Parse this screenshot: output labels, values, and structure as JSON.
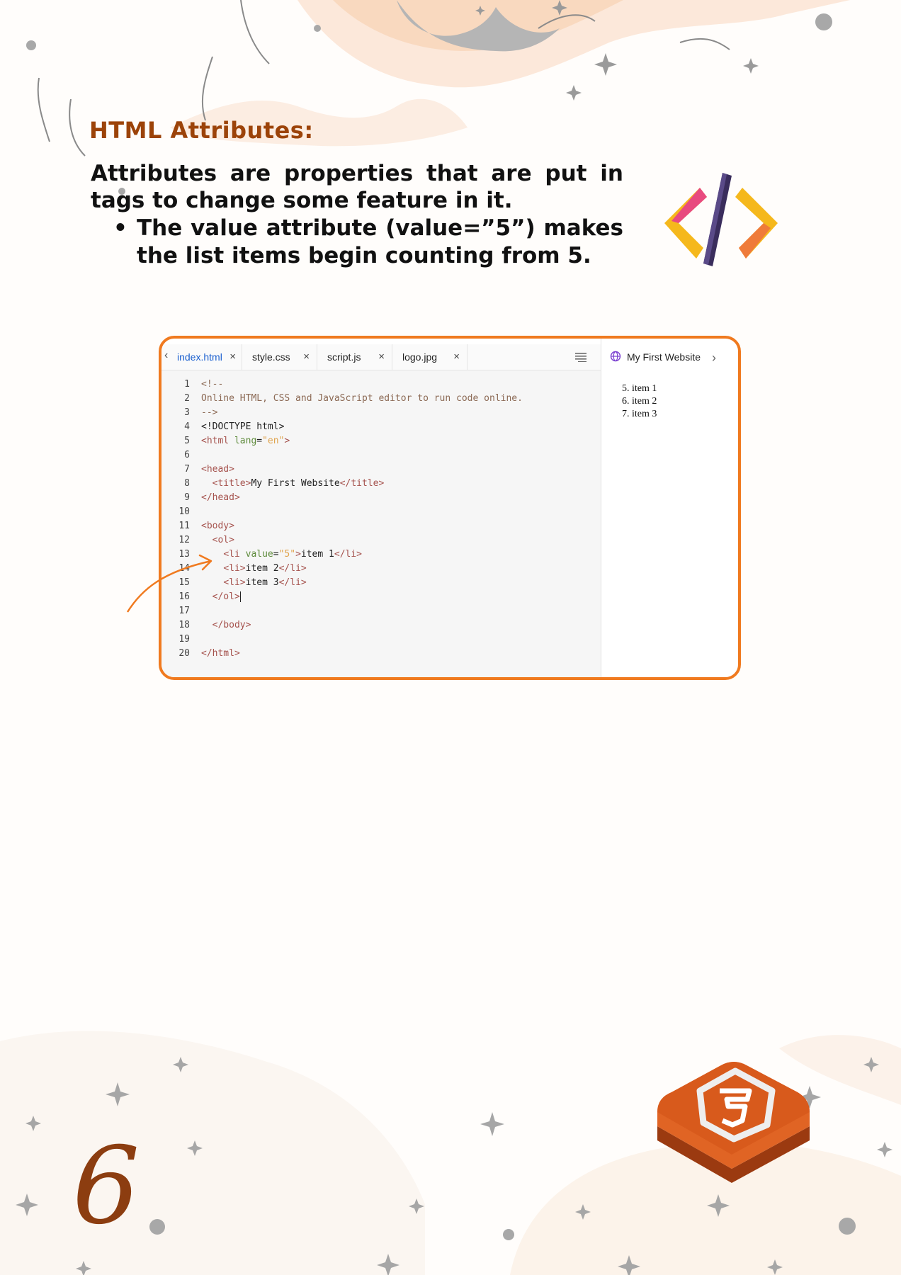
{
  "heading": "HTML Attributes:",
  "intro": "Attributes are properties that are put in tags to change some feature in it.",
  "bullets": [
    "The value attribute (value=”5”) makes the list items begin counting from 5."
  ],
  "editor": {
    "tabs": [
      {
        "label": "index.html",
        "active": true
      },
      {
        "label": "style.css",
        "active": false
      },
      {
        "label": "script.js",
        "active": false
      },
      {
        "label": "logo.jpg",
        "active": false
      }
    ],
    "close_symbol": "×",
    "code_lines": [
      "<!--",
      "Online HTML, CSS and JavaScript editor to run code online.",
      "-->",
      "<!DOCTYPE html>",
      "<html lang=\"en\">",
      "",
      "<head>",
      "  <title>My First Website</title>",
      "</head>",
      "",
      "<body>",
      "  <ol>",
      "    <li value=\"5\">item 1</li>",
      "    <li>item 2</li>",
      "    <li>item 3</li>",
      "  </ol>",
      "",
      "  </body>",
      "",
      "</html>"
    ],
    "line_numbers": [
      "1",
      "2",
      "3",
      "4",
      "5",
      "6",
      "7",
      "8",
      "9",
      "10",
      "11",
      "12",
      "13",
      "14",
      "15",
      "16",
      "17",
      "18",
      "19",
      "20"
    ]
  },
  "preview": {
    "title": "My First Website",
    "items": [
      "5. item 1",
      "6. item 2",
      "7. item 3"
    ]
  },
  "page_number": "6",
  "colors": {
    "heading": "#9c4309",
    "frame_border": "#f07a1f",
    "page_number": "#8c3d10",
    "badge": "#d85a1c"
  },
  "icons": [
    "code-icon",
    "menu-icon",
    "globe-icon",
    "html5-badge-icon",
    "arrow-icon",
    "sparkle-icon"
  ]
}
